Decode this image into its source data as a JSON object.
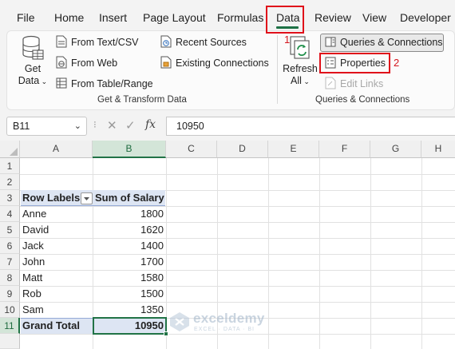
{
  "ribbon_tabs": [
    "File",
    "Home",
    "Insert",
    "Page Layout",
    "Formulas",
    "Data",
    "Review",
    "View",
    "Developer"
  ],
  "active_tab": "Data",
  "get_transform": {
    "get_data_label": "Get",
    "get_data_label2": "Data",
    "from_text_csv": "From Text/CSV",
    "from_web": "From Web",
    "from_table_range": "From Table/Range",
    "recent_sources": "Recent Sources",
    "existing_connections": "Existing Connections",
    "group_label": "Get & Transform Data"
  },
  "queries": {
    "refresh_label": "Refresh",
    "refresh_all_label": "All",
    "queries_connections": "Queries & Connections",
    "properties": "Properties",
    "edit_links": "Edit Links",
    "group_label": "Queries & Connections"
  },
  "annotations": {
    "one": "1",
    "two": "2"
  },
  "formula_bar": {
    "name_box": "B11",
    "fx": "fx",
    "value": "10950"
  },
  "columns": [
    "A",
    "B",
    "C",
    "D",
    "E",
    "F",
    "G",
    "H"
  ],
  "rows": [
    "1",
    "2",
    "3",
    "4",
    "5",
    "6",
    "7",
    "8",
    "9",
    "10",
    "11"
  ],
  "pivot": {
    "header_left": "Row Labels",
    "header_right": "Sum of Salary",
    "items": [
      {
        "name": "Anne",
        "salary": "1800"
      },
      {
        "name": "David",
        "salary": "1620"
      },
      {
        "name": "Jack",
        "salary": "1400"
      },
      {
        "name": "John",
        "salary": "1700"
      },
      {
        "name": "Matt",
        "salary": "1580"
      },
      {
        "name": "Rob",
        "salary": "1500"
      },
      {
        "name": "Sam",
        "salary": "1350"
      }
    ],
    "total_label": "Grand Total",
    "total_value": "10950"
  },
  "watermark": {
    "name": "exceldemy",
    "tagline": "EXCEL · DATA · BI"
  },
  "colors": {
    "excel_green": "#217346",
    "highlight_red": "#e0101a",
    "pivot_blue": "#dde5f3"
  }
}
